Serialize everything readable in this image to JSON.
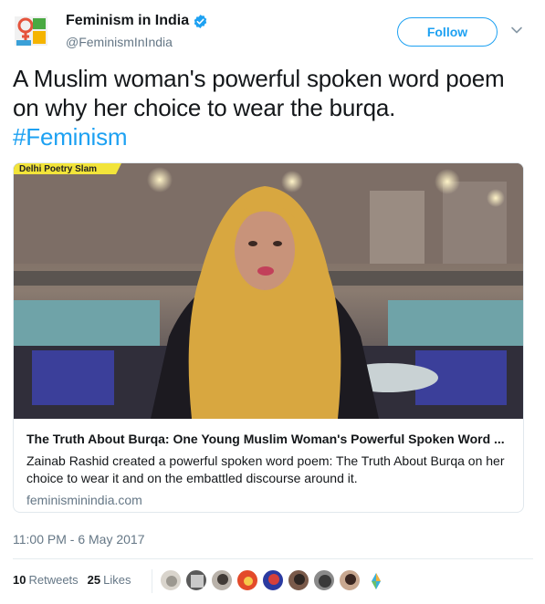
{
  "account": {
    "name": "Feminism in India",
    "handle": "@FeminismInIndia",
    "verified": true,
    "avatar_icon": "feminism-in-india-logo"
  },
  "follow_label": "Follow",
  "tweet": {
    "text": "A Muslim woman's powerful spoken word poem on why her choice to wear the burqa.",
    "hashtag": "#Feminism"
  },
  "card": {
    "overlay_text": "Delhi Poetry Slam",
    "title": "The Truth About Burqa: One Young Muslim Woman's Powerful Spoken Word ...",
    "description": "Zainab Rashid created a powerful spoken word poem: The Truth About Burqa on her choice to wear it and on the embattled discourse around it.",
    "domain": "feminisminindia.com"
  },
  "timestamp": "11:00 PM - 6 May 2017",
  "stats": {
    "retweets_count": "10",
    "retweets_label": "Retweets",
    "likes_count": "25",
    "likes_label": "Likes"
  },
  "colors": {
    "accent": "#1da1f2",
    "text": "#14171a",
    "muted": "#657786",
    "border": "#e1e8ed"
  }
}
